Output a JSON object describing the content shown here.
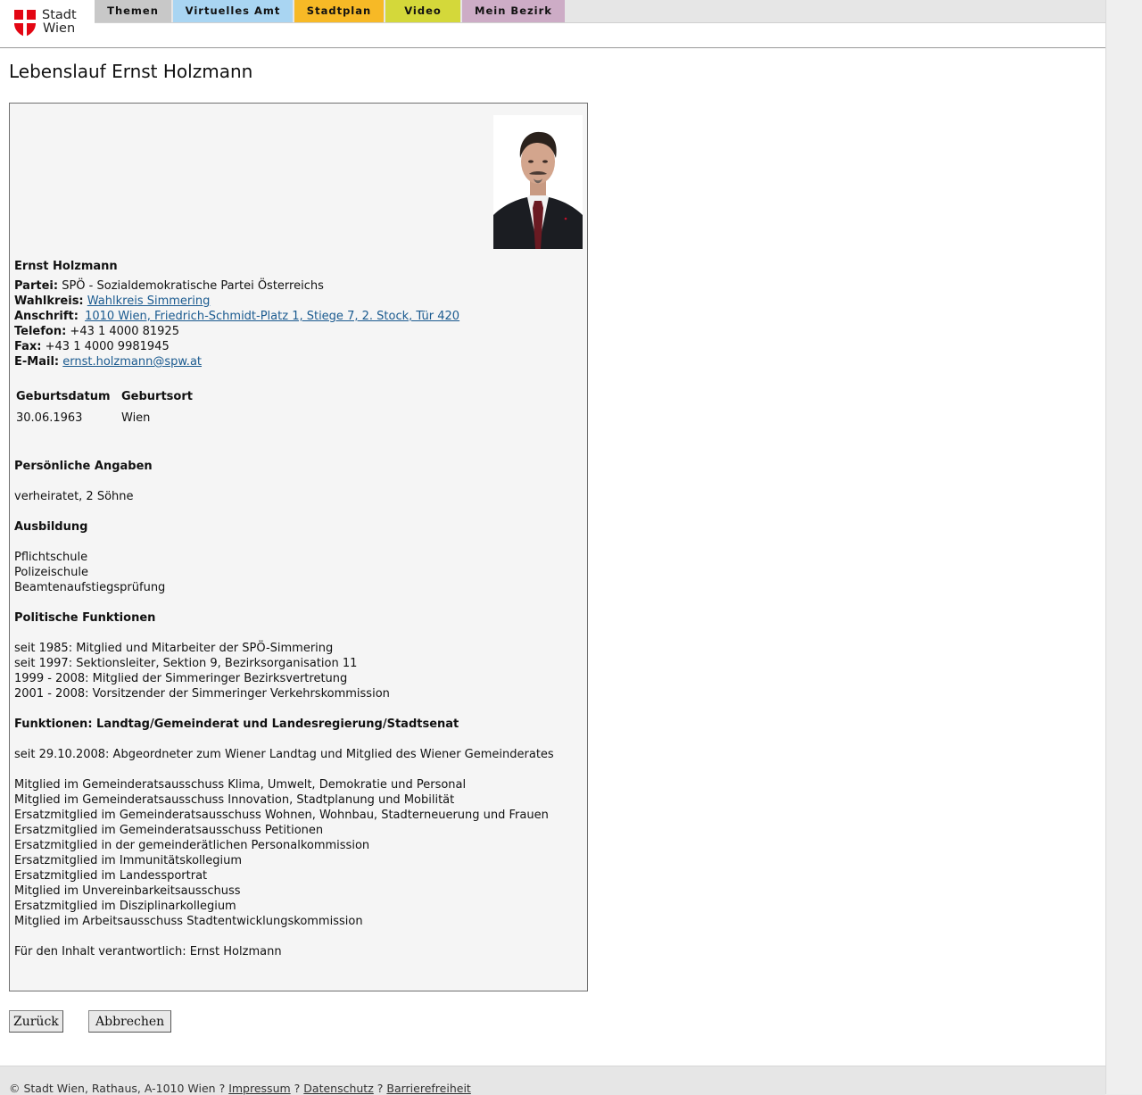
{
  "header": {
    "logo": {
      "line1": "Stadt",
      "line2": "Wien"
    },
    "nav": [
      {
        "label": "Themen",
        "color": "#c8c8c8"
      },
      {
        "label": "Virtuelles Amt",
        "color": "#a9d5f2"
      },
      {
        "label": "Stadtplan",
        "color": "#f7b926"
      },
      {
        "label": "Video",
        "color": "#d4d83a"
      },
      {
        "label": "Mein Bezirk",
        "color": "#cdacc6"
      }
    ]
  },
  "page": {
    "title": "Lebenslauf Ernst Holzmann"
  },
  "profile": {
    "name": "Ernst Holzmann",
    "fields": {
      "partei": {
        "label": "Partei:",
        "value": "SPÖ - Sozialdemokratische Partei Österreichs"
      },
      "wahlkreis": {
        "label": "Wahlkreis:",
        "value": "Wahlkreis Simmering"
      },
      "anschrift": {
        "label": "Anschrift:",
        "value": "1010 Wien, Friedrich-Schmidt-Platz 1, Stiege 7, 2. Stock, Tür 420"
      },
      "telefon": {
        "label": "Telefon:",
        "value": "+43 1 4000 81925"
      },
      "fax": {
        "label": "Fax:",
        "value": "+43 1 4000 9981945"
      },
      "email": {
        "label": "E-Mail:",
        "value": "ernst.holzmann@spw.at"
      }
    },
    "birth": {
      "headers": [
        "Geburtsdatum",
        "Geburtsort"
      ],
      "values": [
        "30.06.1963",
        "Wien"
      ]
    },
    "sections": {
      "personal": {
        "heading": "Persönliche Angaben",
        "lines": [
          "verheiratet, 2 Söhne"
        ]
      },
      "education": {
        "heading": "Ausbildung",
        "lines": [
          "Pflichtschule",
          "Polizeischule",
          "Beamtenaufstiegsprüfung"
        ]
      },
      "political": {
        "heading": "Politische Funktionen",
        "lines": [
          "seit 1985: Mitglied und Mitarbeiter der SPÖ-Simmering",
          "seit 1997: Sektionsleiter, Sektion 9, Bezirksorganisation 11",
          "1999 - 2008: Mitglied der Simmeringer Bezirksvertretung",
          "2001 - 2008: Vorsitzender der Simmeringer Verkehrskommission"
        ]
      },
      "functions": {
        "heading": "Funktionen: Landtag/Gemeinderat und Landesregierung/Stadtsenat",
        "lines": [
          "seit 29.10.2008: Abgeordneter zum Wiener Landtag und Mitglied des Wiener Gemeinderates"
        ],
        "committees": [
          "Mitglied im Gemeinderatsausschuss Klima, Umwelt, Demokratie und Personal",
          "Mitglied im Gemeinderatsausschuss Innovation, Stadtplanung und Mobilität",
          "Ersatzmitglied im Gemeinderatsausschuss Wohnen, Wohnbau, Stadterneuerung und Frauen",
          "Ersatzmitglied im Gemeinderatsausschuss Petitionen",
          "Ersatzmitglied in der gemeinderätlichen Personalkommission",
          "Ersatzmitglied im Immunitätskollegium",
          "Ersatzmitglied im Landessportrat",
          "Mitglied im Unvereinbarkeitsausschuss",
          "Ersatzmitglied im Disziplinarkollegium",
          "Mitglied im Arbeitsausschuss Stadtentwicklungskommission"
        ]
      }
    },
    "responsible": "Für den Inhalt verantwortlich: Ernst Holzmann"
  },
  "buttons": {
    "back": "Zurück",
    "cancel": "Abbrechen"
  },
  "footer": {
    "copyright": "© Stadt Wien, Rathaus, A-1010 Wien",
    "separator": "?",
    "links": [
      "Impressum",
      "Datenschutz",
      "Barrierefreiheit"
    ]
  },
  "colors": {
    "brand_red": "#e30613",
    "link": "#1a5a8f",
    "box_bg": "#f5f5f5"
  }
}
